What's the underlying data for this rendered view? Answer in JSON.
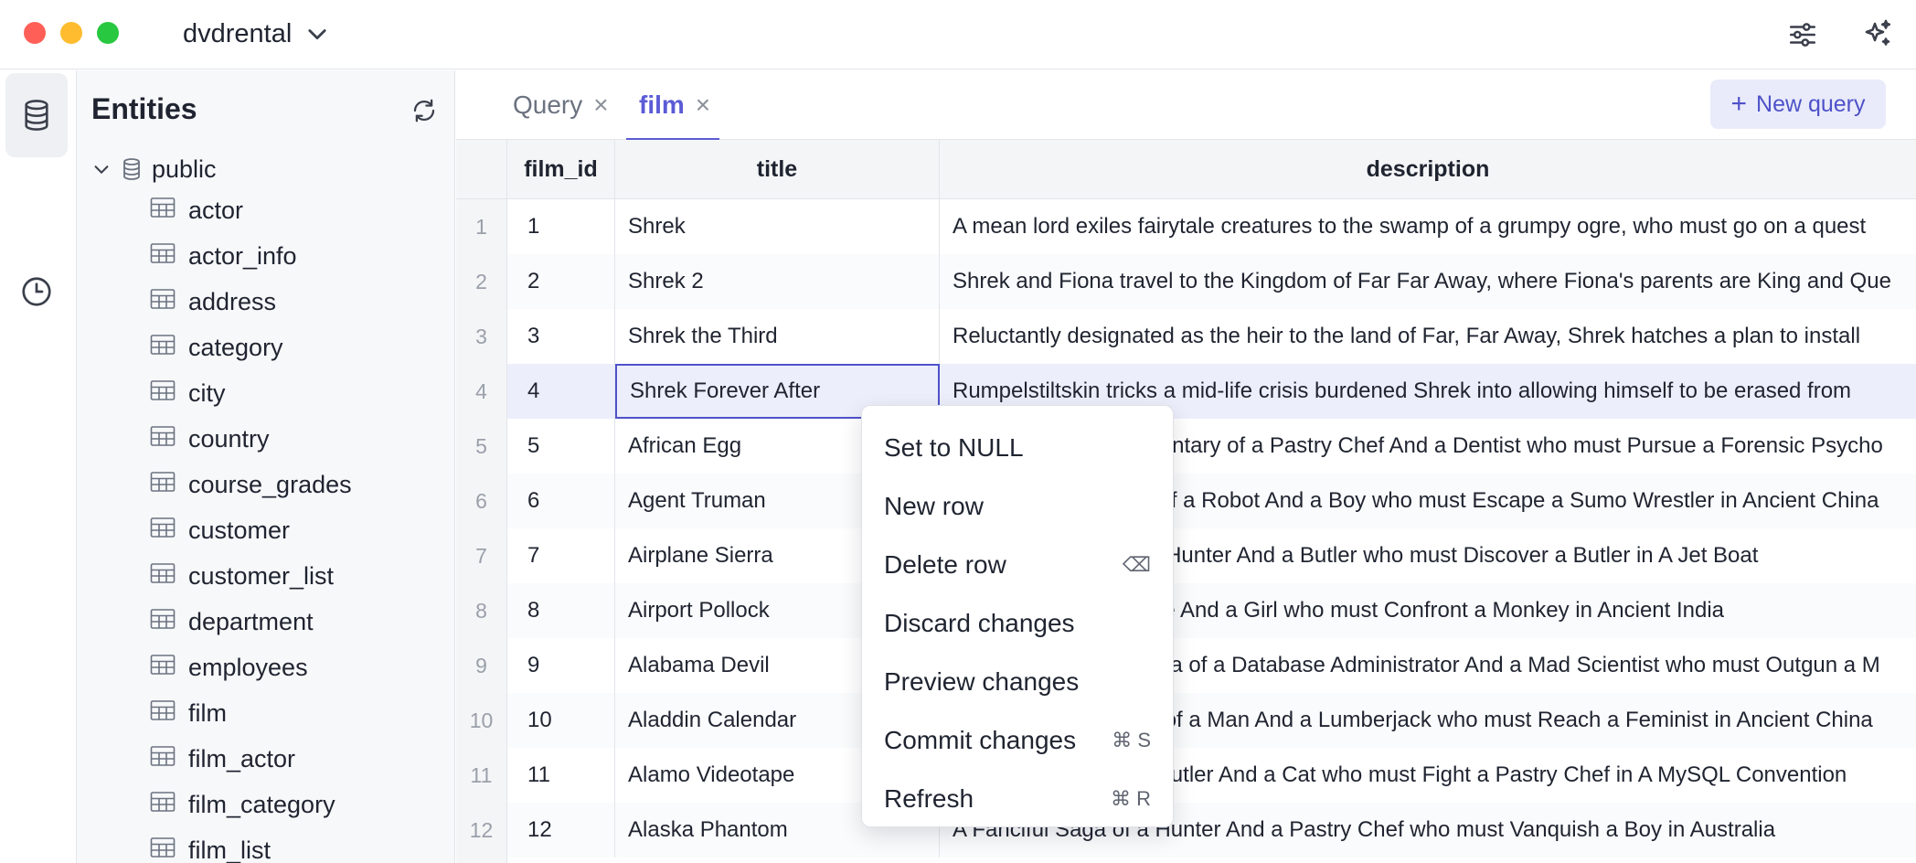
{
  "titlebar": {
    "database": "dvdrental",
    "icons": [
      "chevron-down-icon",
      "sliders-icon",
      "sparkles-icon"
    ]
  },
  "activity": {
    "icons": [
      "database-icon",
      "clock-icon"
    ]
  },
  "sidebar": {
    "title": "Entities",
    "schema": "public",
    "tables": [
      "actor",
      "actor_info",
      "address",
      "category",
      "city",
      "country",
      "course_grades",
      "customer",
      "customer_list",
      "department",
      "employees",
      "film",
      "film_actor",
      "film_category",
      "film_list"
    ]
  },
  "tabs": {
    "items": [
      {
        "label": "Query"
      },
      {
        "label": "film"
      }
    ],
    "new_query": "New query"
  },
  "grid": {
    "columns": [
      "film_id",
      "title",
      "description"
    ],
    "rows": [
      {
        "n": "1",
        "id": "1",
        "title": "Shrek",
        "desc": "A mean lord exiles fairytale creatures to the swamp of a grumpy ogre, who must go on a quest"
      },
      {
        "n": "2",
        "id": "2",
        "title": "Shrek 2",
        "desc": "Shrek and Fiona travel to the Kingdom of Far Far Away, where Fiona's parents are King and Que"
      },
      {
        "n": "3",
        "id": "3",
        "title": "Shrek the Third",
        "desc": "Reluctantly designated as the heir to the land of Far, Far Away, Shrek hatches a plan to install"
      },
      {
        "n": "4",
        "id": "4",
        "title": "Shrek Forever After",
        "desc": "Rumpelstiltskin tricks a mid-life crisis burdened Shrek into allowing himself to be erased from"
      },
      {
        "n": "5",
        "id": "5",
        "title": "African Egg",
        "desc": "A Fast-Paced Documentary of a Pastry Chef And a Dentist who must Pursue a Forensic Psycho"
      },
      {
        "n": "6",
        "id": "6",
        "title": "Agent Truman",
        "desc": "A Intrepid Panorama of a Robot And a Boy who must Escape a Sumo Wrestler in Ancient China"
      },
      {
        "n": "7",
        "id": "7",
        "title": "Airplane Sierra",
        "desc": "A Touching Saga of a Hunter And a Butler who must Discover a Butler in A Jet Boat"
      },
      {
        "n": "8",
        "id": "8",
        "title": "Airport Pollock",
        "desc": "A Epic Tale of a Moose And a Girl who must Confront a Monkey in Ancient India"
      },
      {
        "n": "9",
        "id": "9",
        "title": "Alabama Devil",
        "desc": "A Thoughtful Panorama of a Database Administrator And a Mad Scientist who must Outgun a M"
      },
      {
        "n": "10",
        "id": "10",
        "title": "Aladdin Calendar",
        "desc": "A Action-Packed Tale of a Man And a Lumberjack who must Reach a Feminist in Ancient China"
      },
      {
        "n": "11",
        "id": "11",
        "title": "Alamo Videotape",
        "desc": "A Boring Epistle of a Butler And a Cat who must Fight a Pastry Chef in A MySQL Convention"
      },
      {
        "n": "12",
        "id": "12",
        "title": "Alaska Phantom",
        "desc": "A Fanciful Saga of a Hunter And a Pastry Chef who must Vanquish a Boy in Australia"
      }
    ],
    "selected_row": "4"
  },
  "context_menu": {
    "items": [
      {
        "label": "Set to NULL",
        "shortcut": ""
      },
      {
        "label": "New row",
        "shortcut": ""
      },
      {
        "label": "Delete row",
        "shortcut": "⌫"
      },
      {
        "label": "Discard changes",
        "shortcut": ""
      },
      {
        "label": "Preview changes",
        "shortcut": ""
      },
      {
        "label": "Commit changes",
        "shortcut": "⌘ S"
      },
      {
        "label": "Refresh",
        "shortcut": "⌘ R"
      }
    ]
  },
  "colors": {
    "accent": "#5b5bd6",
    "selection": "#eceefb",
    "close_red": "#ff5f57",
    "minimize_yellow": "#febc2e",
    "zoom_green": "#28c840"
  }
}
